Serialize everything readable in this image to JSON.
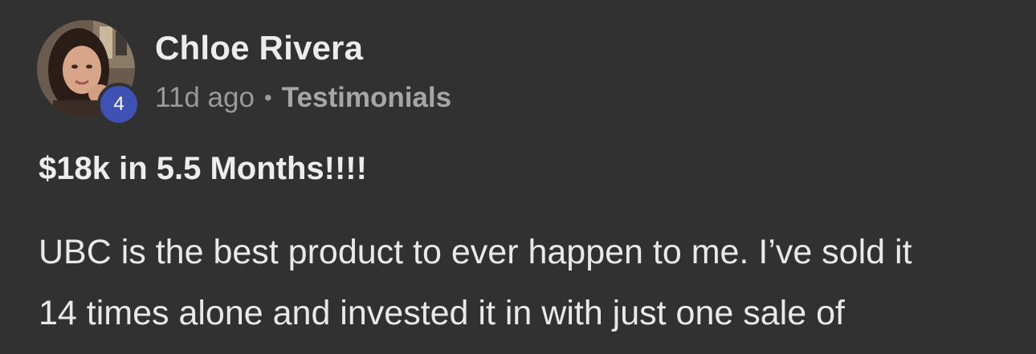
{
  "post": {
    "author": {
      "name": "Chloe Rivera",
      "level": "4"
    },
    "meta": {
      "time": "11d ago",
      "separator": "•",
      "category": "Testimonials"
    },
    "title": "$18k in 5.5 Months!!!!",
    "body_lines": [
      "UBC is the best product to ever happen to me. I’ve sold it",
      "14 times alone and invested it in with just one sale of"
    ]
  },
  "colors": {
    "background": "#313131",
    "badge": "#3f51b5",
    "text_primary": "#ececec",
    "text_secondary": "#9a9a9a"
  }
}
